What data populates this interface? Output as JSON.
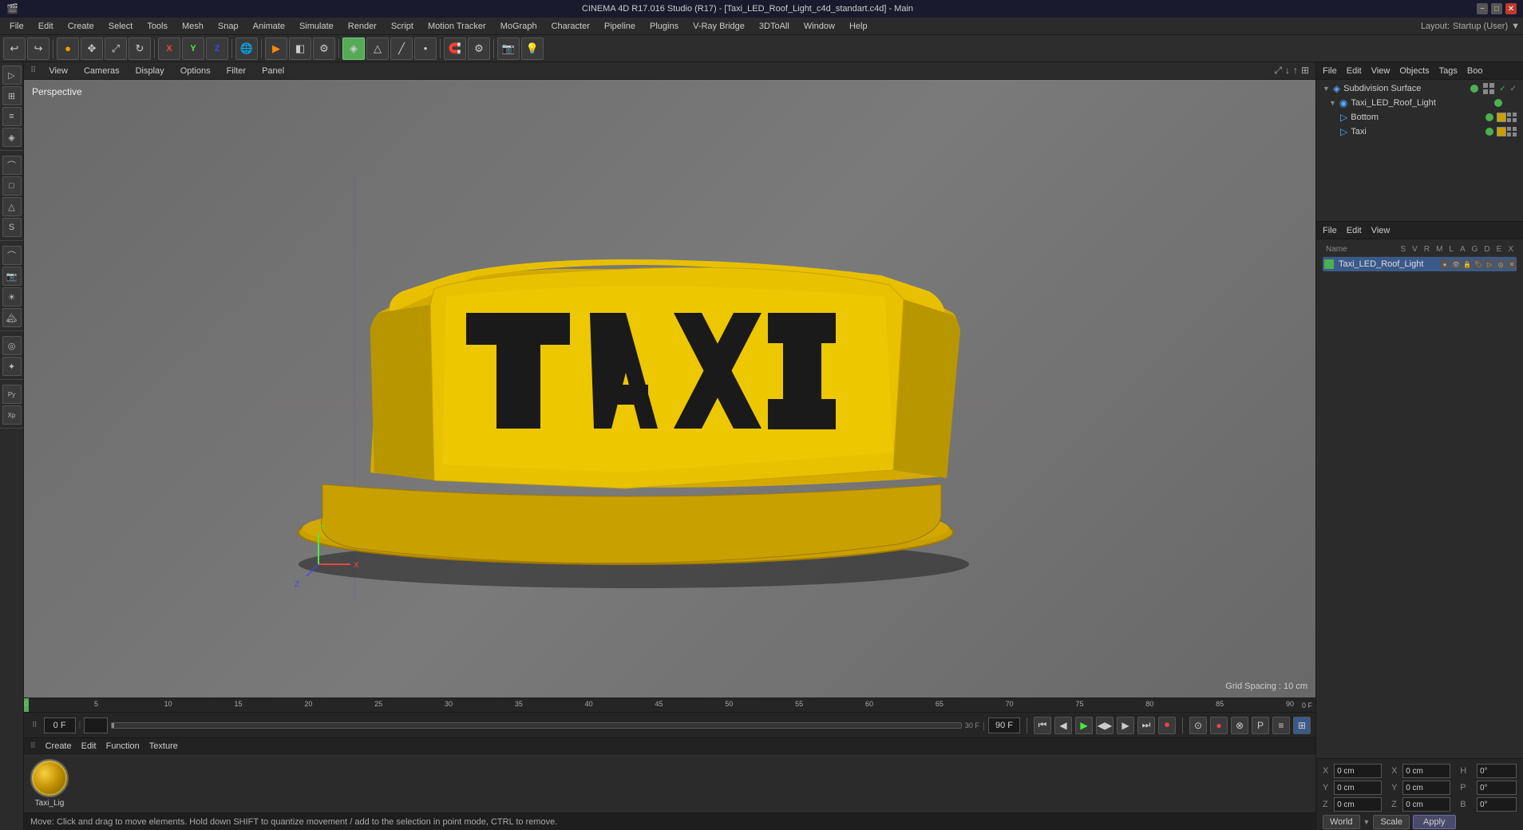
{
  "titlebar": {
    "title": "CINEMA 4D R17.016 Studio (R17) - [Taxi_LED_Roof_Light_c4d_standart.c4d] - Main",
    "buttons": [
      "−",
      "□",
      "✕"
    ]
  },
  "menubar": {
    "items": [
      "File",
      "Edit",
      "Create",
      "Select",
      "Tools",
      "Mesh",
      "Snap",
      "Animate",
      "Simulate",
      "Render",
      "Script",
      "Motion Tracker",
      "MoGraph",
      "Character",
      "Pipeline",
      "Plugins",
      "V-Ray Bridge",
      "3DToAll",
      "Script",
      "Window",
      "Help"
    ],
    "layout_label": "Layout:",
    "layout_value": "Startup (User)"
  },
  "viewport": {
    "menus": [
      "View",
      "Cameras",
      "Display",
      "Options",
      "Filter",
      "Panel"
    ],
    "label": "Perspective",
    "grid_spacing": "Grid Spacing : 10 cm"
  },
  "object_manager": {
    "menus": [
      "File",
      "Edit",
      "View",
      "Objects",
      "Tags",
      "Boo"
    ],
    "items": [
      {
        "name": "Subdivision Surface",
        "indent": 0,
        "icon": "subdiv",
        "dot_color": "green",
        "has_check": true
      },
      {
        "name": "Taxi_LED_Roof_Light",
        "indent": 1,
        "icon": "object",
        "dot_color": "green"
      },
      {
        "name": "Bottom",
        "indent": 2,
        "icon": "object",
        "dot_color": "green",
        "has_material": true
      },
      {
        "name": "Taxi",
        "indent": 2,
        "icon": "object",
        "dot_color": "green",
        "has_material": true
      }
    ]
  },
  "attributes_panel": {
    "menus": [
      "File",
      "Edit",
      "View"
    ],
    "columns": [
      "Name",
      "S",
      "V",
      "R",
      "M",
      "L",
      "A",
      "G",
      "D",
      "E",
      "X"
    ],
    "item": {
      "name": "Taxi_LED_Roof_Light",
      "icons": [
        "dot",
        "eye",
        "lock",
        "tag",
        "x"
      ]
    }
  },
  "coordinates": {
    "x_label": "X",
    "y_label": "Y",
    "z_label": "Z",
    "x_val": "0 cm",
    "y_val": "0 cm",
    "z_val": "0 cm",
    "x2_label": "X",
    "y2_label": "Y",
    "z2_label": "Z",
    "x2_val": "0 cm",
    "y2_val": "0 cm",
    "z2_val": "0 cm",
    "h_label": "H",
    "p_label": "P",
    "b_label": "B",
    "h_val": "0°",
    "p_val": "0°",
    "b_val": "0°",
    "world_btn": "World",
    "scale_btn": "Scale",
    "apply_btn": "Apply"
  },
  "timeline": {
    "start": "0 F",
    "end": "90 F",
    "current": "0 F",
    "markers": [
      0,
      5,
      10,
      15,
      20,
      25,
      30,
      35,
      40,
      45,
      50,
      55,
      60,
      65,
      70,
      75,
      80,
      85,
      90
    ]
  },
  "material_panel": {
    "menus": [
      "Create",
      "Edit",
      "Function",
      "Texture"
    ],
    "materials": [
      {
        "name": "Taxi_Lig",
        "type": "gold"
      }
    ]
  },
  "statusbar": {
    "text": "Move: Click and drag to move elements. Hold down SHIFT to quantize movement / add to the selection in point mode, CTRL to remove."
  },
  "icons": {
    "move": "✥",
    "rotate": "↻",
    "scale": "⤢",
    "x_axis": "X",
    "y_axis": "Y",
    "z_axis": "Z",
    "play": "▶",
    "stop": "■",
    "prev": "⏮",
    "next": "⏭",
    "rewind": "◀◀",
    "forward": "▶▶",
    "record": "⏺"
  }
}
